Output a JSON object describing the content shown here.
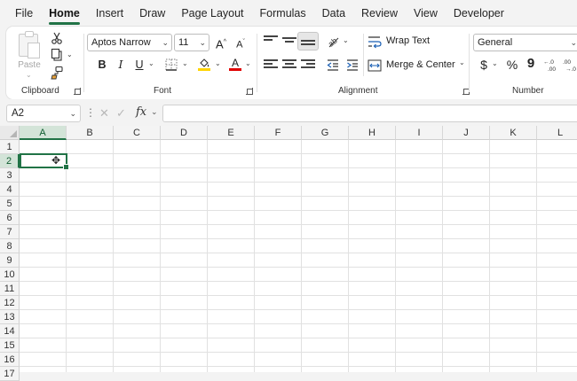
{
  "menu": {
    "tabs": [
      "File",
      "Home",
      "Insert",
      "Draw",
      "Page Layout",
      "Formulas",
      "Data",
      "Review",
      "View",
      "Developer"
    ],
    "active_tab": "Home"
  },
  "ribbon": {
    "clipboard": {
      "label": "Clipboard",
      "paste_label": "Paste"
    },
    "font": {
      "label": "Font",
      "font_name": "Aptos Narrow",
      "font_size": "11",
      "bold": "B",
      "italic": "I",
      "underline": "U"
    },
    "alignment": {
      "label": "Alignment",
      "wrap_text": "Wrap Text",
      "merge_center": "Merge & Center"
    },
    "number": {
      "label": "Number",
      "format": "General",
      "currency": "$",
      "percent": "%",
      "comma": "9"
    }
  },
  "formula_bar": {
    "name_box": "A2",
    "fx_label": "fx",
    "value": ""
  },
  "sheet": {
    "columns": [
      "A",
      "B",
      "C",
      "D",
      "E",
      "F",
      "G",
      "H",
      "I",
      "J",
      "K",
      "L"
    ],
    "rows": [
      "1",
      "2",
      "3",
      "4",
      "5",
      "6",
      "7",
      "8",
      "9",
      "10",
      "11",
      "12",
      "13",
      "14",
      "15",
      "16",
      "17"
    ],
    "active_cell": "A2",
    "selected_column": "A",
    "selected_row": "2"
  },
  "colors": {
    "accent": "#217346",
    "font_highlight": "#ffd400",
    "font_color": "#e00000"
  }
}
